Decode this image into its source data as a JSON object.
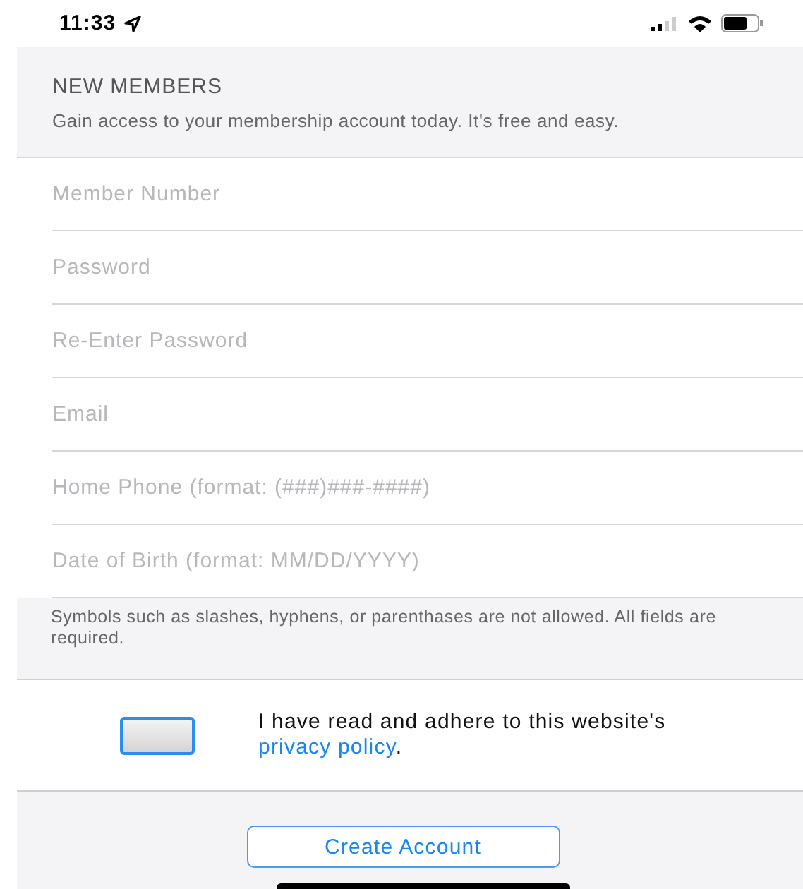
{
  "status_bar": {
    "time": "11:33"
  },
  "header": {
    "title": "NEW MEMBERS",
    "subtitle": "Gain access to your membership account today. It's free and easy."
  },
  "fields": [
    {
      "placeholder": "Member Number"
    },
    {
      "placeholder": "Password"
    },
    {
      "placeholder": "Re-Enter Password"
    },
    {
      "placeholder": "Email"
    },
    {
      "placeholder": "Home Phone (format: (###)###-####)"
    },
    {
      "placeholder": "Date of Birth (format: MM/DD/YYYY)"
    }
  ],
  "note": "Symbols such as slashes, hyphens, or parenthases are not allowed. All fields are required.",
  "agreement": {
    "checked": false,
    "text": "I have read and adhere to this website's",
    "link": "privacy policy",
    "end": "."
  },
  "button": "Create Account"
}
